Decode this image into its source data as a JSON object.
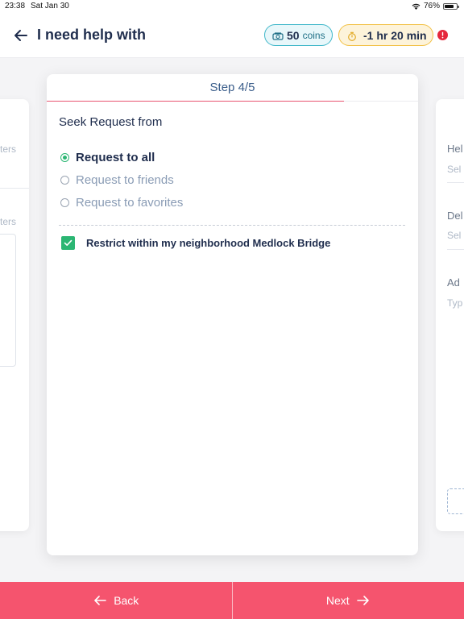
{
  "status_bar": {
    "time": "23:38",
    "date": "Sat Jan 30",
    "battery": "76%",
    "battery_level": 0.76
  },
  "header": {
    "title": "I need help with",
    "coins": {
      "value": "50",
      "unit": "coins"
    },
    "timer": {
      "value": "-1 hr 20 min"
    }
  },
  "left_card": {
    "fragment_1": "ters",
    "fragment_2": "ters"
  },
  "right_card": {
    "field_1_label": "Hel",
    "field_1_value": "Sel",
    "field_2_label": "Del",
    "field_2_value": "Sel",
    "field_3_label": "Ad",
    "field_3_value": "Typ"
  },
  "wizard": {
    "step_label": "Step 4/5",
    "current_step": 4,
    "total_steps": 5,
    "section_title": "Seek Request from",
    "options": [
      {
        "label": "Request to all",
        "selected": true
      },
      {
        "label": "Request to friends",
        "selected": false
      },
      {
        "label": "Request to favorites",
        "selected": false
      }
    ],
    "restrict_checkbox": {
      "label": "Restrict within my neighborhood Medlock Bridge",
      "checked": true
    }
  },
  "footer": {
    "back_label": "Back",
    "next_label": "Next"
  },
  "colors": {
    "accent": "#f5546e",
    "success": "#2bb673",
    "navy": "#1f2d4d",
    "coins_border": "#3fb7c9",
    "timer_border": "#f2c146",
    "alert": "#e5283c"
  }
}
